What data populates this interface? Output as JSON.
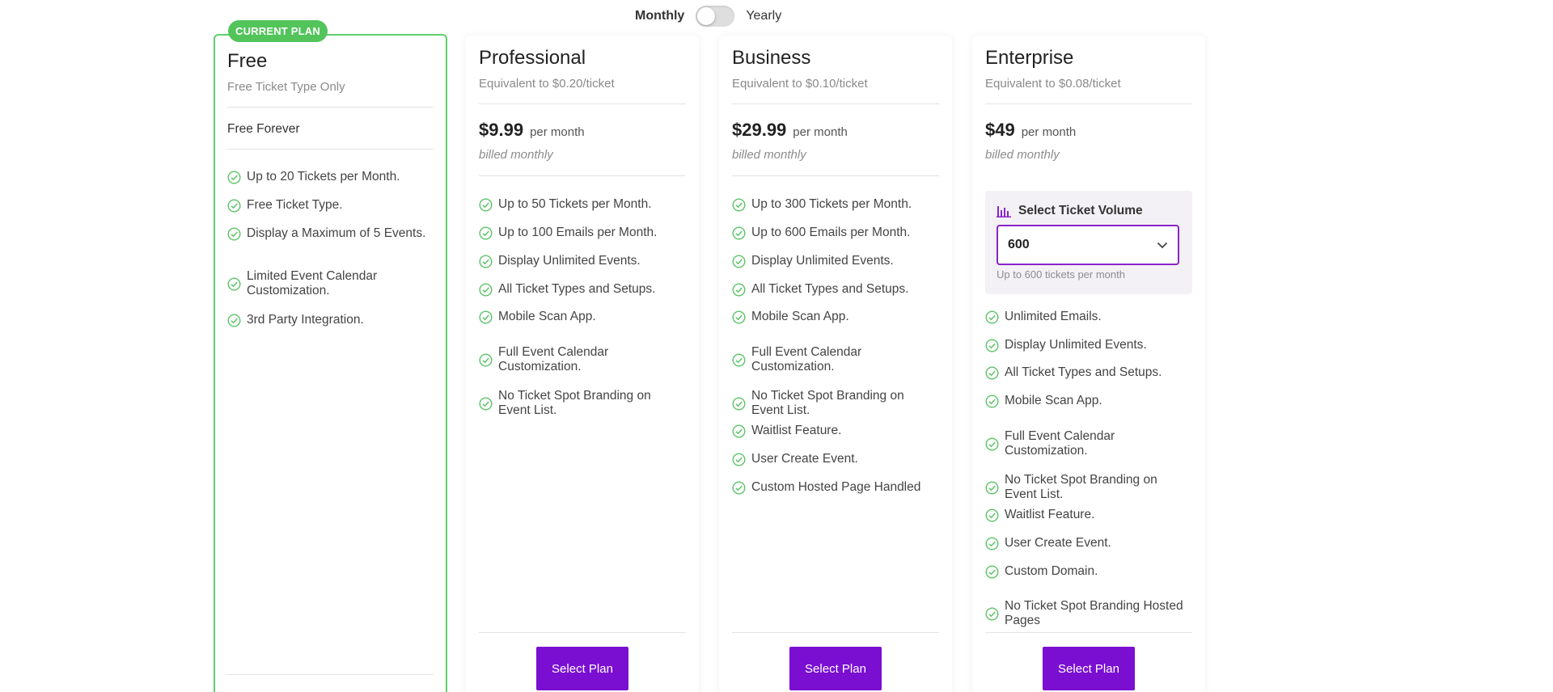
{
  "billing": {
    "monthly_label": "Monthly",
    "yearly_label": "Yearly"
  },
  "colors": {
    "accent": "#7a0fd1",
    "current_border": "#5fcf6b",
    "check": "#5bc467"
  },
  "plans": {
    "free": {
      "badge": "CURRENT PLAN",
      "name": "Free",
      "subtitle": "Free Ticket Type Only",
      "price_label": "Free Forever",
      "features": [
        "Up to 20 Tickets per Month.",
        "Free Ticket Type.",
        "Display a Maximum of 5 Events.",
        "Limited Event Calendar Customization.",
        "3rd Party Integration."
      ]
    },
    "professional": {
      "name": "Professional",
      "subtitle": "Equivalent to $0.20/ticket",
      "price": "$9.99",
      "period": "per month",
      "billed": "billed monthly",
      "features": [
        "Up to 50 Tickets per Month.",
        "Up to 100 Emails per Month.",
        "Display Unlimited Events.",
        "All Ticket Types and Setups.",
        "Mobile Scan App.",
        "Full Event Calendar Customization.",
        "No Ticket Spot Branding on Event List."
      ],
      "button": "Select Plan"
    },
    "business": {
      "name": "Business",
      "subtitle": "Equivalent to $0.10/ticket",
      "price": "$29.99",
      "period": "per month",
      "billed": "billed monthly",
      "features": [
        "Up to 300 Tickets per Month.",
        "Up to 600 Emails per Month.",
        "Display Unlimited Events.",
        "All Ticket Types and Setups.",
        "Mobile Scan App.",
        "Full Event Calendar Customization.",
        "No Ticket Spot Branding on Event List.",
        "Waitlist Feature.",
        "User Create Event.",
        "Custom Hosted Page Handled"
      ],
      "button": "Select Plan"
    },
    "enterprise": {
      "name": "Enterprise",
      "subtitle": "Equivalent to $0.08/ticket",
      "price": "$49",
      "period": "per month",
      "billed": "billed monthly",
      "volume": {
        "title": "Select Ticket Volume",
        "value": "600",
        "note": "Up to 600 tickets per month"
      },
      "features": [
        "Unlimited Emails.",
        "Display Unlimited Events.",
        "All Ticket Types and Setups.",
        "Mobile Scan App.",
        "Full Event Calendar Customization.",
        "No Ticket Spot Branding on Event List.",
        "Waitlist Feature.",
        "User Create Event.",
        "Custom Domain.",
        "No Ticket Spot Branding Hosted Pages"
      ],
      "button": "Select Plan"
    }
  }
}
